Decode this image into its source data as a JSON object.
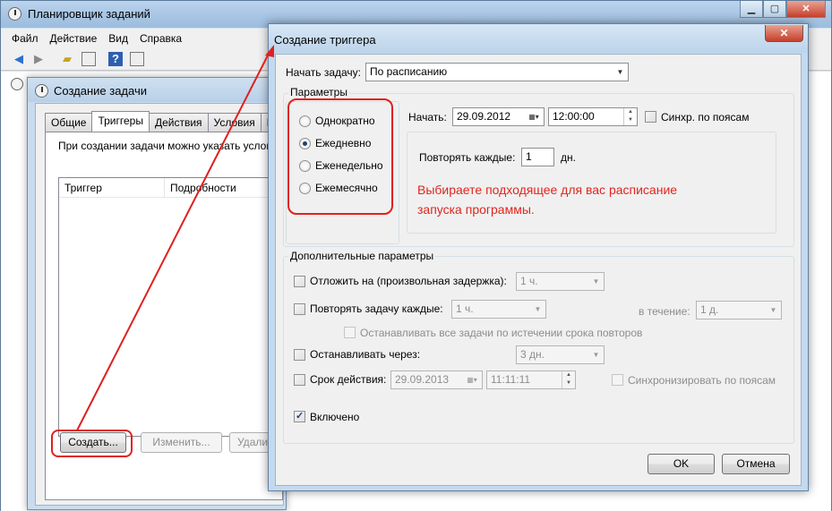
{
  "main_window": {
    "title": "Планировщик заданий",
    "menu": [
      "Файл",
      "Действие",
      "Вид",
      "Справка"
    ],
    "controls": {
      "min": "▁",
      "max": "▢",
      "close": "✕"
    },
    "toolbar_icons": [
      "back-arrow-icon",
      "forward-arrow-icon",
      "folder-up-icon",
      "console-tree-icon",
      "help-icon",
      "action-pane-icon"
    ]
  },
  "task_dialog": {
    "title": "Создание задачи",
    "tabs": [
      "Общие",
      "Триггеры",
      "Действия",
      "Условия",
      "П"
    ],
    "active_tab": "Триггеры",
    "description": "При создании задачи можно указать услов",
    "table_headers": [
      "Триггер",
      "Подробности"
    ],
    "buttons": {
      "create": "Создать...",
      "edit": "Изменить...",
      "delete": "Удалит"
    }
  },
  "trigger_dialog": {
    "title": "Создание триггера",
    "close": "✕",
    "start_task_label": "Начать задачу:",
    "start_task_value": "По расписанию",
    "params_group": "Параметры",
    "schedule_options": [
      "Однократно",
      "Ежедневно",
      "Еженедельно",
      "Ежемесячно"
    ],
    "selected_option": "Ежедневно",
    "start_label": "Начать:",
    "start_date": "29.09.2012",
    "start_time": "12:00:00",
    "sync_tz_label": "Синхр. по поясам",
    "repeat_every_label": "Повторять каждые:",
    "repeat_every_value": "1",
    "repeat_every_unit": "дн.",
    "annotation": "Выбираете подходящее для вас расписание запуска программы.",
    "advanced_group": "Дополнительные параметры",
    "delay_label": "Отложить на (произвольная задержка):",
    "delay_value": "1 ч.",
    "repeat_task_label": "Повторять задачу каждые:",
    "repeat_task_value": "1 ч.",
    "duration_label": "в течение:",
    "duration_value": "1 д.",
    "stop_all_label": "Останавливать все задачи по истечении срока повторов",
    "stop_after_label": "Останавливать через:",
    "stop_after_value": "3 дн.",
    "expire_label": "Срок действия:",
    "expire_date": "29.09.2013",
    "expire_time": "11:11:11",
    "sync_expire_label": "Синхронизировать по поясам",
    "enabled_label": "Включено",
    "enabled": true,
    "ok": "OK",
    "cancel": "Отмена"
  },
  "colors": {
    "annotation_red": "#e0261e",
    "title_bar": "#bdd4ea"
  }
}
